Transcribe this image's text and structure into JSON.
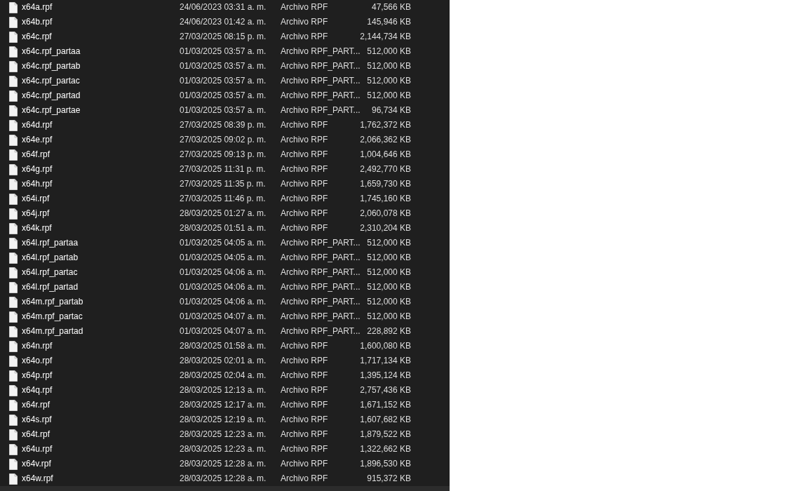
{
  "files": [
    {
      "name": "x64a.rpf",
      "modified": "24/06/2023 03:31 a. m.",
      "type": "Archivo RPF",
      "size": "47,566 KB"
    },
    {
      "name": "x64b.rpf",
      "modified": "24/06/2023 01:42 a. m.",
      "type": "Archivo RPF",
      "size": "145,946 KB"
    },
    {
      "name": "x64c.rpf",
      "modified": "27/03/2025 08:15 p. m.",
      "type": "Archivo RPF",
      "size": "2,144,734 KB"
    },
    {
      "name": "x64c.rpf_partaa",
      "modified": "01/03/2025 03:57 a. m.",
      "type": "Archivo RPF_PART...",
      "size": "512,000 KB"
    },
    {
      "name": "x64c.rpf_partab",
      "modified": "01/03/2025 03:57 a. m.",
      "type": "Archivo RPF_PART...",
      "size": "512,000 KB"
    },
    {
      "name": "x64c.rpf_partac",
      "modified": "01/03/2025 03:57 a. m.",
      "type": "Archivo RPF_PART...",
      "size": "512,000 KB"
    },
    {
      "name": "x64c.rpf_partad",
      "modified": "01/03/2025 03:57 a. m.",
      "type": "Archivo RPF_PART...",
      "size": "512,000 KB"
    },
    {
      "name": "x64c.rpf_partae",
      "modified": "01/03/2025 03:57 a. m.",
      "type": "Archivo RPF_PART...",
      "size": "96,734 KB"
    },
    {
      "name": "x64d.rpf",
      "modified": "27/03/2025 08:39 p. m.",
      "type": "Archivo RPF",
      "size": "1,762,372 KB"
    },
    {
      "name": "x64e.rpf",
      "modified": "27/03/2025 09:02 p. m.",
      "type": "Archivo RPF",
      "size": "2,066,362 KB"
    },
    {
      "name": "x64f.rpf",
      "modified": "27/03/2025 09:13 p. m.",
      "type": "Archivo RPF",
      "size": "1,004,646 KB"
    },
    {
      "name": "x64g.rpf",
      "modified": "27/03/2025 11:31 p. m.",
      "type": "Archivo RPF",
      "size": "2,492,770 KB"
    },
    {
      "name": "x64h.rpf",
      "modified": "27/03/2025 11:35 p. m.",
      "type": "Archivo RPF",
      "size": "1,659,730 KB"
    },
    {
      "name": "x64i.rpf",
      "modified": "27/03/2025 11:46 p. m.",
      "type": "Archivo RPF",
      "size": "1,745,160 KB"
    },
    {
      "name": "x64j.rpf",
      "modified": "28/03/2025 01:27 a. m.",
      "type": "Archivo RPF",
      "size": "2,060,078 KB"
    },
    {
      "name": "x64k.rpf",
      "modified": "28/03/2025 01:51 a. m.",
      "type": "Archivo RPF",
      "size": "2,310,204 KB"
    },
    {
      "name": "x64l.rpf_partaa",
      "modified": "01/03/2025 04:05 a. m.",
      "type": "Archivo RPF_PART...",
      "size": "512,000 KB"
    },
    {
      "name": "x64l.rpf_partab",
      "modified": "01/03/2025 04:05 a. m.",
      "type": "Archivo RPF_PART...",
      "size": "512,000 KB"
    },
    {
      "name": "x64l.rpf_partac",
      "modified": "01/03/2025 04:06 a. m.",
      "type": "Archivo RPF_PART...",
      "size": "512,000 KB"
    },
    {
      "name": "x64l.rpf_partad",
      "modified": "01/03/2025 04:06 a. m.",
      "type": "Archivo RPF_PART...",
      "size": "512,000 KB"
    },
    {
      "name": "x64m.rpf_partab",
      "modified": "01/03/2025 04:06 a. m.",
      "type": "Archivo RPF_PART...",
      "size": "512,000 KB"
    },
    {
      "name": "x64m.rpf_partac",
      "modified": "01/03/2025 04:07 a. m.",
      "type": "Archivo RPF_PART...",
      "size": "512,000 KB"
    },
    {
      "name": "x64m.rpf_partad",
      "modified": "01/03/2025 04:07 a. m.",
      "type": "Archivo RPF_PART...",
      "size": "228,892 KB"
    },
    {
      "name": "x64n.rpf",
      "modified": "28/03/2025 01:58 a. m.",
      "type": "Archivo RPF",
      "size": "1,600,080 KB"
    },
    {
      "name": "x64o.rpf",
      "modified": "28/03/2025 02:01 a. m.",
      "type": "Archivo RPF",
      "size": "1,717,134 KB"
    },
    {
      "name": "x64p.rpf",
      "modified": "28/03/2025 02:04 a. m.",
      "type": "Archivo RPF",
      "size": "1,395,124 KB"
    },
    {
      "name": "x64q.rpf",
      "modified": "28/03/2025 12:13 a. m.",
      "type": "Archivo RPF",
      "size": "2,757,436 KB"
    },
    {
      "name": "x64r.rpf",
      "modified": "28/03/2025 12:17 a. m.",
      "type": "Archivo RPF",
      "size": "1,671,152 KB"
    },
    {
      "name": "x64s.rpf",
      "modified": "28/03/2025 12:19 a. m.",
      "type": "Archivo RPF",
      "size": "1,607,682 KB"
    },
    {
      "name": "x64t.rpf",
      "modified": "28/03/2025 12:23 a. m.",
      "type": "Archivo RPF",
      "size": "1,879,522 KB"
    },
    {
      "name": "x64u.rpf",
      "modified": "28/03/2025 12:23 a. m.",
      "type": "Archivo RPF",
      "size": "1,322,662 KB"
    },
    {
      "name": "x64v.rpf",
      "modified": "28/03/2025 12:28 a. m.",
      "type": "Archivo RPF",
      "size": "1,896,530 KB"
    },
    {
      "name": "x64w.rpf",
      "modified": "28/03/2025 12:28 a. m.",
      "type": "Archivo RPF",
      "size": "915,372 KB"
    }
  ]
}
